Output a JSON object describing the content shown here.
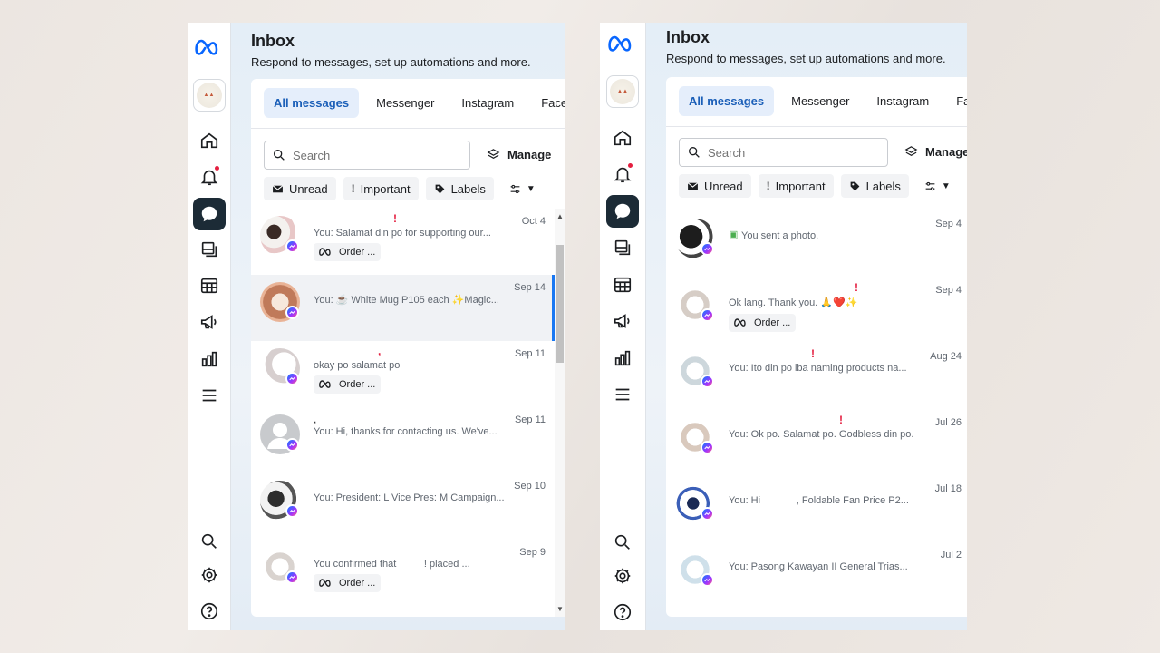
{
  "colors": {
    "accent": "#1877f2",
    "brand": "#0866ff",
    "alert": "#e41e3f",
    "active_rail": "#1c2b36"
  },
  "panels": [
    {
      "header": {
        "title": "Inbox",
        "subtitle": "Respond to messages, set up automations and more."
      },
      "tabs": [
        "All messages",
        "Messenger",
        "Instagram",
        "Faceb"
      ],
      "search": {
        "placeholder": "Search"
      },
      "manage_label": "Manage",
      "filters": {
        "unread": "Unread",
        "important": "Important",
        "labels": "Labels"
      },
      "conversations": [
        {
          "name": "",
          "important": true,
          "date": "Oct 4",
          "preview": "You: Salamat din po for supporting our...",
          "order_label": "Order ..."
        },
        {
          "name": "",
          "important": false,
          "date": "Sep 14",
          "preview": "You: ☕ White Mug P105 each ✨Magic...",
          "order_label": ""
        },
        {
          "name": "",
          "important": true,
          "date": "Sep 11",
          "preview": "okay po salamat po",
          "order_label": "Order ..."
        },
        {
          "name": ",",
          "important": false,
          "date": "Sep 11",
          "preview": "You: Hi, thanks for contacting us. We've...",
          "order_label": ""
        },
        {
          "name": "",
          "important": false,
          "date": "Sep 10",
          "preview": "You: President: L Vice Pres: M Campaign...",
          "order_label": ""
        },
        {
          "name": "",
          "important": false,
          "date": "Sep 9",
          "preview": "You confirmed that          ! placed ...",
          "order_label": "Order ..."
        }
      ]
    },
    {
      "header": {
        "title": "Inbox",
        "subtitle": "Respond to messages, set up automations and more."
      },
      "tabs": [
        "All messages",
        "Messenger",
        "Instagram",
        "Fa"
      ],
      "search": {
        "placeholder": "Search"
      },
      "manage_label": "Manage",
      "filters": {
        "unread": "Unread",
        "important": "Important",
        "labels": "Labels"
      },
      "conversations": [
        {
          "name": "",
          "important": false,
          "date": "Sep 4",
          "preview": "You sent a photo.",
          "order_label": ""
        },
        {
          "name": "",
          "important": true,
          "date": "Sep 4",
          "preview": "Ok lang. Thank you. 🙏❤️✨",
          "order_label": "Order ..."
        },
        {
          "name": "",
          "important": true,
          "date": "Aug 24",
          "preview": "You: Ito din po iba naming products na...",
          "order_label": ""
        },
        {
          "name": "",
          "important": true,
          "date": "Jul 26",
          "preview": "You: Ok po. Salamat po. Godbless din po.",
          "order_label": ""
        },
        {
          "name": "",
          "important": false,
          "date": "Jul 18",
          "preview": "You: Hi             , Foldable Fan Price P2...",
          "order_label": ""
        },
        {
          "name": "",
          "important": false,
          "date": "Jul 2",
          "preview": "You: Pasong Kawayan II General Trias...",
          "order_label": ""
        }
      ]
    }
  ]
}
